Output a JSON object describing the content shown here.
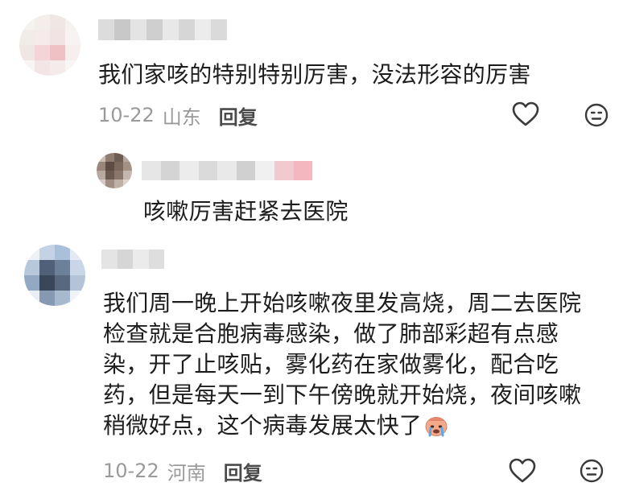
{
  "comments": [
    {
      "text": "我们家咳的特别特别厉害，没法形容的厉害",
      "date": "10-22",
      "location": "山东",
      "reply_label": "回复",
      "colors": {
        "avatar": [
          "#f3efed",
          "#f6e7e6",
          "#f1c9cb",
          "#f7f2f1"
        ]
      },
      "replies": [
        {
          "text": "咳嗽厉害赶紧去医院",
          "colors": {
            "avatar": [
              "#a69488",
              "#7b6a60",
              "#d9cdc6",
              "#5e5048"
            ]
          }
        }
      ]
    },
    {
      "text": "我们周一晚上开始咳嗽夜里发高烧，周二去医院检查就是合胞病毒感染，做了肺部彩超有点感染，开了止咳贴，雾化药在家做雾化，配合吃药，但是每天一到下午傍晚就开始烧，夜间咳嗽稍微好点，这个病毒发展太快了",
      "emoji": "crying-emoji",
      "date": "10-22",
      "location": "河南",
      "reply_label": "回复",
      "colors": {
        "avatar": [
          "#a8bed8",
          "#5f7289",
          "#d7e1ee",
          "#3c4a5d"
        ]
      }
    }
  ],
  "icons": {
    "like": "heart-outline-icon",
    "react": "emoji-face-icon"
  }
}
